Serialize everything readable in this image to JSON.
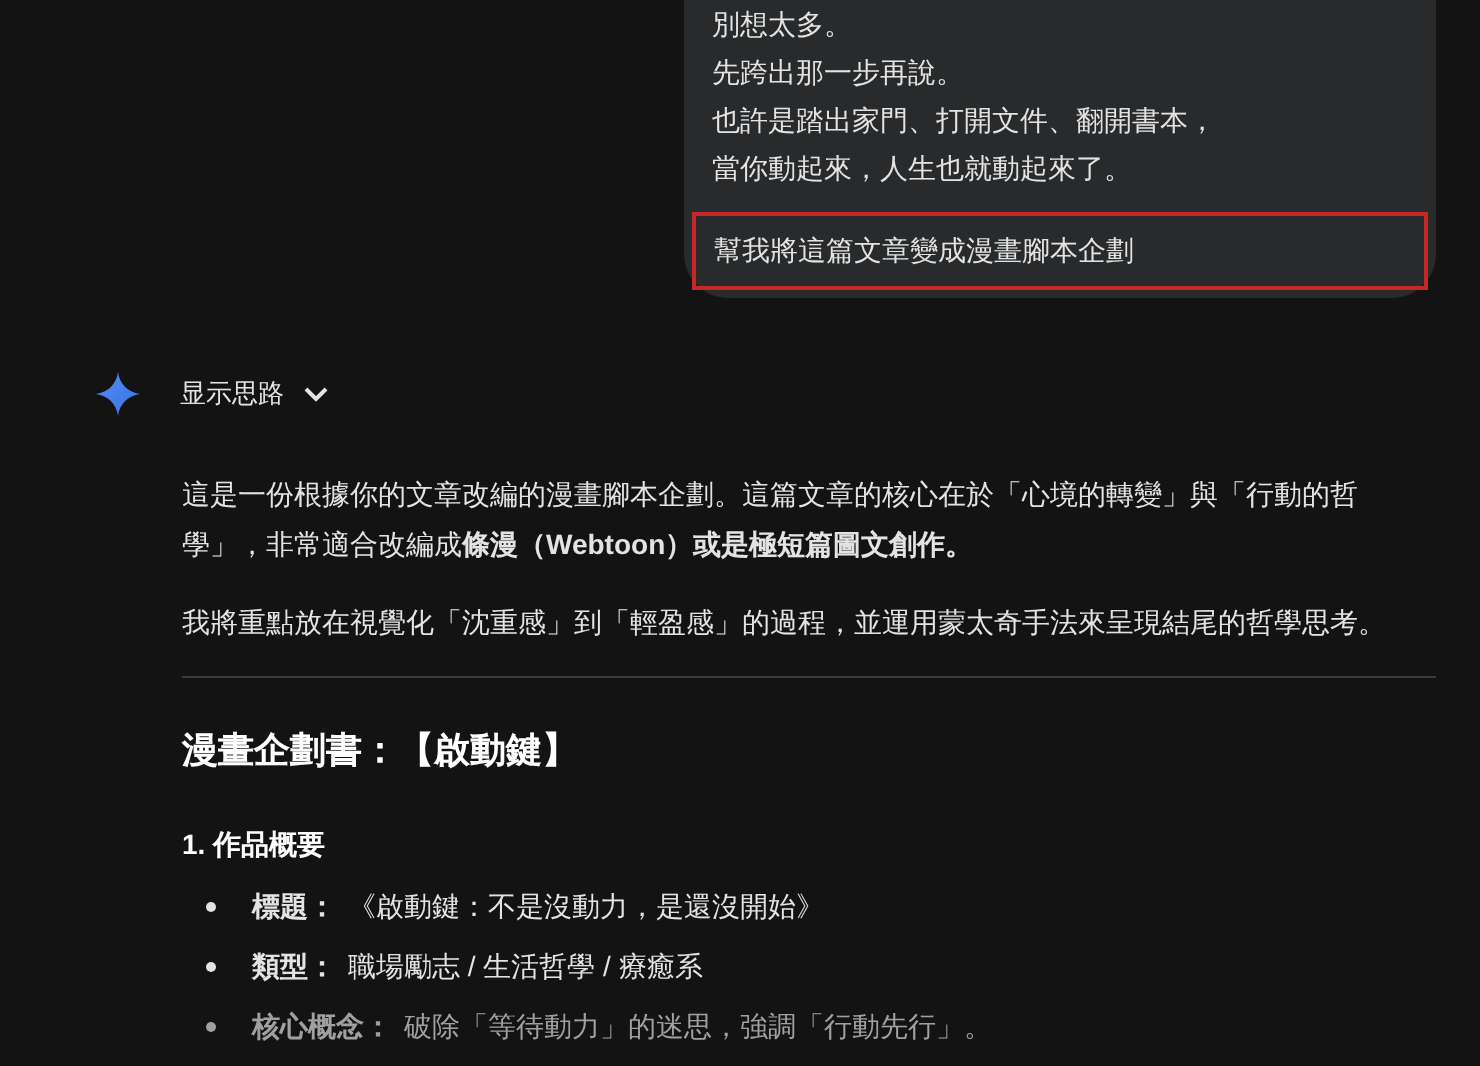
{
  "user_message": {
    "lines": [
      "別想太多。",
      "先跨出那一步再說。",
      "也許是踏出家門、打開文件、翻開書本，",
      "當你動起來，人生也就動起來了。"
    ],
    "request": {
      "text": "幫我將這篇文章變成漫畫腳本企劃",
      "highlighted": true
    }
  },
  "response": {
    "thoughts_toggle": {
      "label": "显示思路",
      "expanded": false
    },
    "paragraphs": [
      "這是一份根據你的文章改編的漫畫腳本企劃。這篇文章的核心在於「心境的轉變」與「行動的哲學」，非常適合改編成**條漫（Webtoon）或是極短篇圖文創作。**",
      "我將重點放在視覺化「沈重感」到「輕盈感」的過程，並運用蒙太奇手法來呈現結尾的哲學思考。"
    ],
    "heading": "漫畫企劃書：【啟動鍵】",
    "section": "1. 作品概要",
    "bullets": [
      {
        "label": "標題：",
        "text": "《啟動鍵：不是沒動力，是還沒開始》",
        "faded": false
      },
      {
        "label": "類型：",
        "text": "職場勵志 / 生活哲學 / 療癒系",
        "faded": false
      },
      {
        "label": "核心概念：",
        "text": "破除「等待動力」的迷思，強調「行動先行」。",
        "faded": true
      }
    ]
  }
}
